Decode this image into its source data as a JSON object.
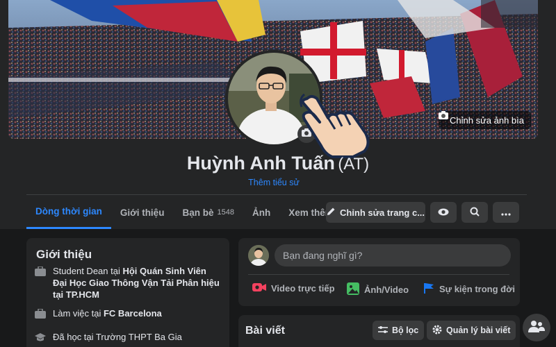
{
  "profile": {
    "name": "Huỳnh Anh Tuấn",
    "nickname": "(AT)",
    "add_bio": "Thêm tiểu sử",
    "edit_cover": "Chỉnh sửa ảnh bìa"
  },
  "tabs": [
    {
      "label": "Dòng thời gian",
      "active": true
    },
    {
      "label": "Giới thiệu"
    },
    {
      "label": "Bạn bè",
      "count": "1548"
    },
    {
      "label": "Ảnh"
    },
    {
      "label": "Xem thêm"
    }
  ],
  "actions": {
    "edit_profile": "Chỉnh sửa trang c...",
    "view_as_icon": "eye-icon",
    "search_icon": "search-icon",
    "more_icon": "more-icon"
  },
  "intro": {
    "title": "Giới thiệu",
    "items": [
      {
        "prefix": "Student Dean tại ",
        "bold": "Hội Quán Sinh Viên Đại Học Giao Thông Vận Tải Phân hiệu tại TP.HCM"
      },
      {
        "prefix": "Làm việc tại ",
        "bold": "FC Barcelona"
      },
      {
        "prefix": "Đã học tại ",
        "bold": "Trường THPT Ba Gia"
      }
    ]
  },
  "composer": {
    "placeholder": "Bạn đang nghĩ gì?",
    "live_video": "Video trực tiếp",
    "photo_video": "Ảnh/Video",
    "life_event": "Sự kiện trong đời"
  },
  "posts": {
    "title": "Bài viết",
    "filter": "Bộ lọc",
    "manage": "Quản lý bài viết"
  },
  "colors": {
    "accent": "#2d88ff",
    "background": "#18191a",
    "card": "#242526",
    "button": "#3a3b3c",
    "live_red": "#f3425f",
    "photo_green": "#45bd62",
    "event_blue": "#1877f2"
  }
}
